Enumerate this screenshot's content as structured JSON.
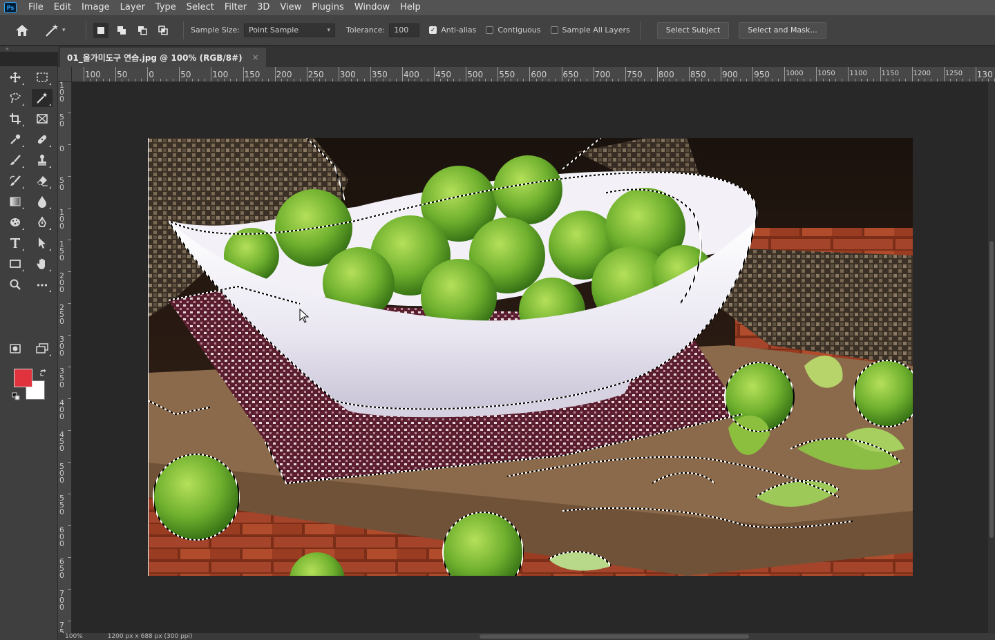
{
  "menubar": {
    "logo": "Ps",
    "items": [
      "File",
      "Edit",
      "Image",
      "Layer",
      "Type",
      "Select",
      "Filter",
      "3D",
      "View",
      "Plugins",
      "Window",
      "Help"
    ]
  },
  "options": {
    "sample_size_label": "Sample Size:",
    "sample_size_value": "Point Sample",
    "tolerance_label": "Tolerance:",
    "tolerance_value": "100",
    "anti_alias_label": "Anti-alias",
    "anti_alias_checked": true,
    "contiguous_label": "Contiguous",
    "contiguous_checked": false,
    "sample_all_layers_label": "Sample All Layers",
    "sample_all_layers_checked": false,
    "select_subject_label": "Select Subject",
    "select_mask_label": "Select and Mask..."
  },
  "collapse_glyph": "«",
  "document": {
    "tab_title": "01_올가미도구 연습.jpg @ 100% (RGB/8#)",
    "close_glyph": "×"
  },
  "ruler_top": {
    "labels": [
      "100",
      "50",
      "0",
      "50",
      "100",
      "150",
      "200",
      "250",
      "300",
      "350",
      "400",
      "450",
      "500",
      "550",
      "600",
      "650",
      "700",
      "750",
      "800",
      "850",
      "900",
      "950",
      "1000",
      "1050",
      "1100",
      "1150",
      "1200",
      "1250",
      "130"
    ]
  },
  "ruler_left": {
    "labels": [
      "100",
      "50",
      "0",
      "50",
      "100",
      "150",
      "200",
      "250",
      "300",
      "350",
      "400",
      "450",
      "500",
      "550",
      "600",
      "650",
      "700",
      "75"
    ]
  },
  "colors": {
    "foreground": "#e0333e",
    "background": "#ffffff"
  },
  "status": {
    "zoom": "100%",
    "doc_info": "1200 px x 688 px (300 ppi)"
  }
}
